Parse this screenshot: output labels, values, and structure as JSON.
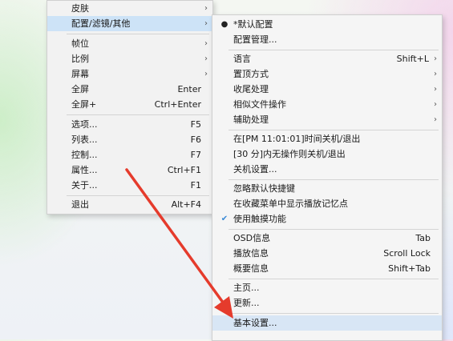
{
  "left_menu": {
    "items": [
      {
        "label": "皮肤",
        "shortcut": "",
        "submenu": true
      },
      {
        "label": "配置/滤镜/其他",
        "shortcut": "",
        "submenu": true
      },
      {
        "label": "帧位",
        "shortcut": "",
        "submenu": true
      },
      {
        "label": "比例",
        "shortcut": "",
        "submenu": true
      },
      {
        "label": "屏幕",
        "shortcut": "",
        "submenu": true
      },
      {
        "label": "全屏",
        "shortcut": "Enter",
        "submenu": false
      },
      {
        "label": "全屏+",
        "shortcut": "Ctrl+Enter",
        "submenu": false
      },
      {
        "label": "选项...",
        "shortcut": "F5",
        "submenu": false
      },
      {
        "label": "列表...",
        "shortcut": "F6",
        "submenu": false
      },
      {
        "label": "控制...",
        "shortcut": "F7",
        "submenu": false
      },
      {
        "label": "属性...",
        "shortcut": "Ctrl+F1",
        "submenu": false
      },
      {
        "label": "关于...",
        "shortcut": "F1",
        "submenu": false
      },
      {
        "label": "退出",
        "shortcut": "Alt+F4",
        "submenu": false
      }
    ]
  },
  "right_menu": {
    "items": [
      {
        "label": "*默认配置",
        "shortcut": "",
        "mark": "bullet"
      },
      {
        "label": "配置管理...",
        "shortcut": ""
      },
      {
        "label": "语言",
        "shortcut": "Shift+L",
        "submenu": true
      },
      {
        "label": "置顶方式",
        "shortcut": "",
        "submenu": true
      },
      {
        "label": "收尾处理",
        "shortcut": "",
        "submenu": true
      },
      {
        "label": "相似文件操作",
        "shortcut": "",
        "submenu": true
      },
      {
        "label": "辅助处理",
        "shortcut": "",
        "submenu": true
      },
      {
        "label": "在[PM 11:01:01]时间关机/退出",
        "shortcut": ""
      },
      {
        "label": "[30 分]内无操作则关机/退出",
        "shortcut": ""
      },
      {
        "label": "关机设置...",
        "shortcut": ""
      },
      {
        "label": "忽略默认快捷键",
        "shortcut": ""
      },
      {
        "label": "在收藏菜单中显示播放记忆点",
        "shortcut": ""
      },
      {
        "label": "使用触摸功能",
        "shortcut": "",
        "mark": "check"
      },
      {
        "label": "OSD信息",
        "shortcut": "Tab"
      },
      {
        "label": "播放信息",
        "shortcut": "Scroll Lock"
      },
      {
        "label": "概要信息",
        "shortcut": "Shift+Tab"
      },
      {
        "label": "主页...",
        "shortcut": ""
      },
      {
        "label": "更新...",
        "shortcut": ""
      },
      {
        "label": "基本设置...",
        "shortcut": ""
      }
    ]
  },
  "colors": {
    "highlight": "#cde3f7",
    "arrow": "#e53b2c",
    "check": "#3a8ad6"
  },
  "icons": {
    "submenu_arrow": "chevron-right-icon",
    "bullet": "bullet-icon",
    "check": "check-icon"
  }
}
